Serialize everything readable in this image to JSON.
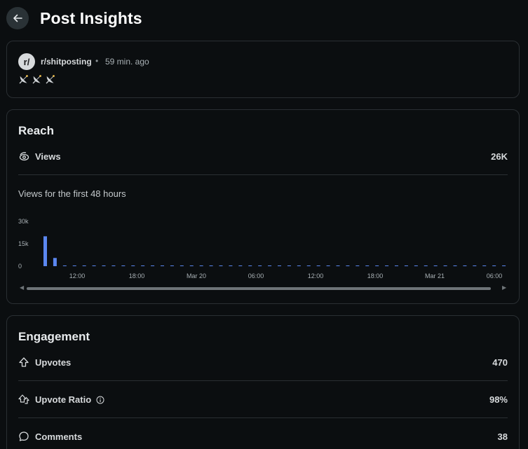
{
  "page": {
    "title": "Post Insights"
  },
  "post": {
    "avatar_text": "r/",
    "subreddit": "r/shitposting",
    "separator": "•",
    "time_ago": "59 min. ago",
    "content_icons": [
      "satellite-dish-icon",
      "satellite-dish-icon",
      "satellite-dish-icon"
    ]
  },
  "reach": {
    "title": "Reach",
    "views_label": "Views",
    "views_value": "26K",
    "chart_subtitle": "Views for the first 48 hours"
  },
  "engagement": {
    "title": "Engagement",
    "upvotes_label": "Upvotes",
    "upvotes_value": "470",
    "upvote_ratio_label": "Upvote Ratio",
    "upvote_ratio_value": "98%",
    "comments_label": "Comments",
    "comments_value": "38"
  },
  "colors": {
    "bar": "#5b87f0",
    "background": "#0b0e10",
    "card_border": "#2a2f33"
  },
  "chart_data": {
    "type": "bar",
    "title": "",
    "xlabel": "",
    "ylabel": "",
    "ylim": [
      0,
      30000
    ],
    "y_ticks": [
      "30k",
      "15k",
      "0"
    ],
    "x_ticks": [
      "12:00",
      "18:00",
      "Mar 20",
      "06:00",
      "12:00",
      "18:00",
      "Mar 21",
      "06:00"
    ],
    "values": [
      20000,
      5500,
      0,
      0,
      0,
      0,
      0,
      0,
      0,
      0,
      0,
      0,
      0,
      0,
      0,
      0,
      0,
      0,
      0,
      0,
      0,
      0,
      0,
      0,
      0,
      0,
      0,
      0,
      0,
      0,
      0,
      0,
      0,
      0,
      0,
      0,
      0,
      0,
      0,
      0,
      0,
      0,
      0,
      0,
      0,
      0,
      0,
      0
    ],
    "grid": false,
    "legend": "none"
  }
}
